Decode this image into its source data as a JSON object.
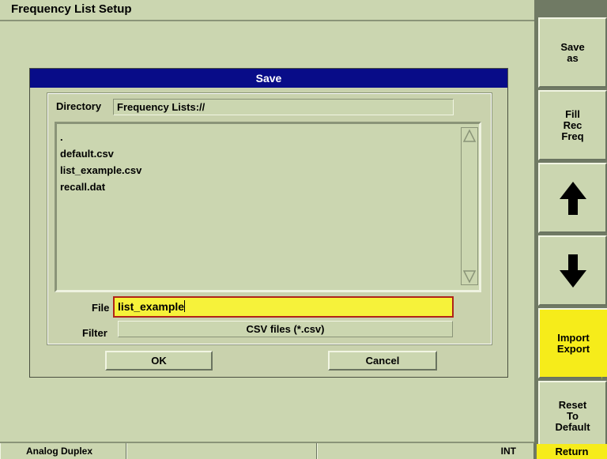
{
  "window": {
    "title": "Frequency List Setup"
  },
  "dialog": {
    "title": "Save",
    "directory_label": "Directory",
    "directory_value": "Frequency Lists://",
    "files": [
      ".",
      "default.csv",
      "list_example.csv",
      "recall.dat"
    ],
    "file_label": "File",
    "file_value": "list_example",
    "filter_label": "Filter",
    "filter_value": "CSV files (*.csv)",
    "ok_label": "OK",
    "cancel_label": "Cancel"
  },
  "softkeys": {
    "save_as": "Save\nas",
    "fill_rec_freq": "Fill\nRec\nFreq",
    "up_icon": "arrow-up-icon",
    "down_icon": "arrow-down-icon",
    "import_export": "Import\nExport",
    "reset_default": "Reset\nTo\nDefault",
    "return": "Return"
  },
  "status": {
    "mode": "Analog Duplex",
    "cell2": "",
    "ref": "INT"
  },
  "colors": {
    "background": "#cbd6b0",
    "dialog_title": "#080c88",
    "highlight": "#f6ec1a",
    "input_border": "#b02418"
  }
}
